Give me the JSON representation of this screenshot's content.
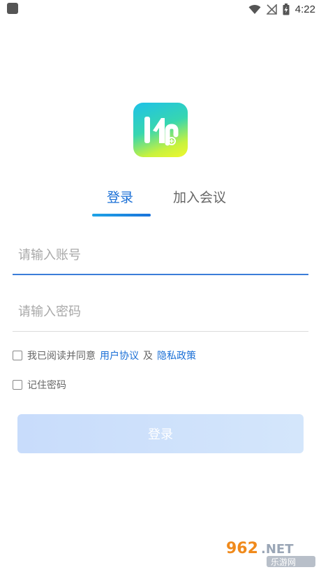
{
  "status_bar": {
    "time": "4:22"
  },
  "tabs": [
    {
      "label": "登录",
      "active": true
    },
    {
      "label": "加入会议",
      "active": false
    }
  ],
  "form": {
    "account_placeholder": "请输入账号",
    "password_placeholder": "请输入密码",
    "agree_prefix": "我已阅读并同意",
    "user_agreement": "用户协议",
    "agree_and": "及",
    "privacy_policy": "隐私政策",
    "remember_password": "记住密码",
    "login_button": "登录"
  },
  "colors": {
    "accent": "#1a6fd6",
    "button_disabled": "#cfe1fb",
    "input_active_line": "#3b7dd8"
  },
  "icons": [
    "app-notification-icon",
    "wifi-icon",
    "signal-off-icon",
    "battery-charging-icon",
    "app-logo-icon"
  ],
  "watermark": {
    "brand": "962.NET",
    "site": "乐游网"
  }
}
